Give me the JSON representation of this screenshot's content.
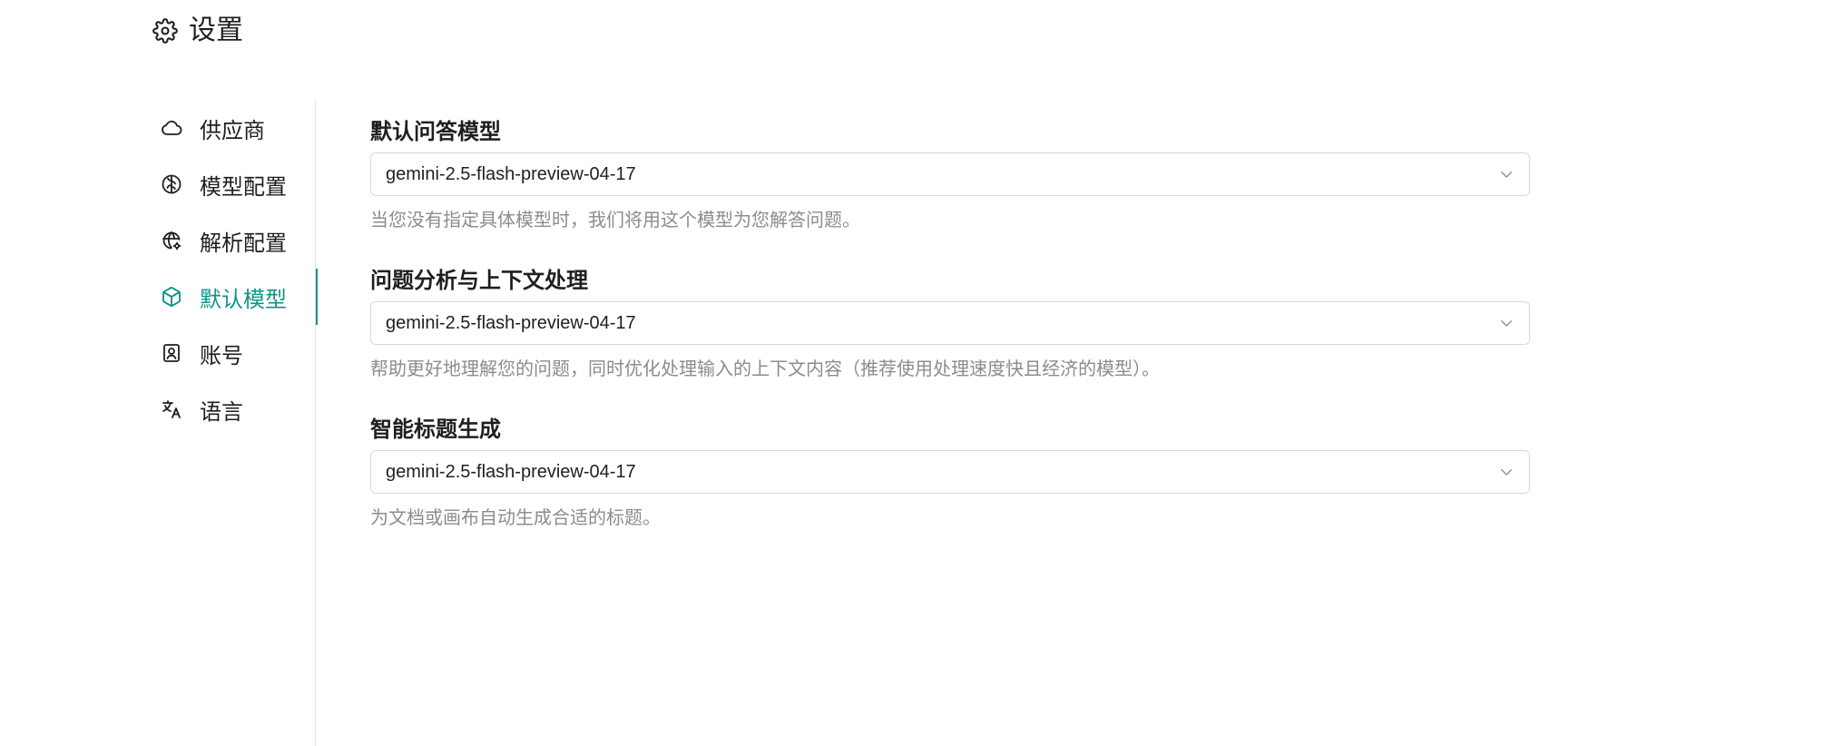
{
  "header": {
    "title": "设置",
    "icon": "gear-icon"
  },
  "sidebar": {
    "items": [
      {
        "label": "供应商",
        "icon": "cloud-icon",
        "active": false
      },
      {
        "label": "模型配置",
        "icon": "brain-icon",
        "active": false
      },
      {
        "label": "解析配置",
        "icon": "globe-gear-icon",
        "active": false
      },
      {
        "label": "默认模型",
        "icon": "cube-icon",
        "active": true
      },
      {
        "label": "账号",
        "icon": "contact-card-icon",
        "active": false
      },
      {
        "label": "语言",
        "icon": "translate-icon",
        "active": false
      }
    ]
  },
  "main": {
    "sections": [
      {
        "title": "默认问答模型",
        "selected": "gemini-2.5-flash-preview-04-17",
        "hint": "当您没有指定具体模型时，我们将用这个模型为您解答问题。"
      },
      {
        "title": "问题分析与上下文处理",
        "selected": "gemini-2.5-flash-preview-04-17",
        "hint": "帮助更好地理解您的问题，同时优化处理输入的上下文内容（推荐使用处理速度快且经济的模型）。"
      },
      {
        "title": "智能标题生成",
        "selected": "gemini-2.5-flash-preview-04-17",
        "hint": "为文档或画布自动生成合适的标题。"
      }
    ]
  },
  "colors": {
    "accent": "#0f9488",
    "text": "#1f1f1f",
    "muted": "#8c8c8c",
    "border": "#d9d9d9"
  }
}
